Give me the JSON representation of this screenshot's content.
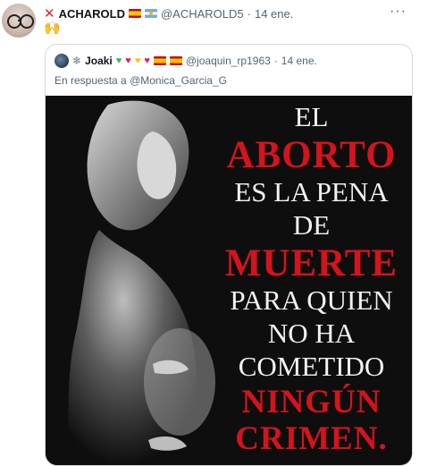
{
  "tweet": {
    "display_name": "ACHAROLD",
    "handle": "@ACHAROLD5",
    "separator": "·",
    "date": "14 ene.",
    "body_emoji": "🙌",
    "more_label": "···"
  },
  "quoted_tweet": {
    "display_name": "Joaki",
    "handle": "@joaquin_rp1963",
    "separator": "·",
    "date": "14 ene.",
    "reply_prefix": "En respuesta a",
    "reply_mention": "@Monica_Garcia_G",
    "image_text": {
      "line1": "EL",
      "line2": "ABORTO",
      "line3": "ES LA PENA",
      "line4": "DE",
      "line5": "MUERTE",
      "line6": "PARA QUIEN",
      "line7": "NO HA",
      "line8": "COMETIDO",
      "line9": "NINGÚN",
      "line10": "CRIMEN."
    }
  },
  "colors": {
    "accent_red": "#d3141c",
    "muted_text": "#536471",
    "border": "#cfd9de"
  }
}
